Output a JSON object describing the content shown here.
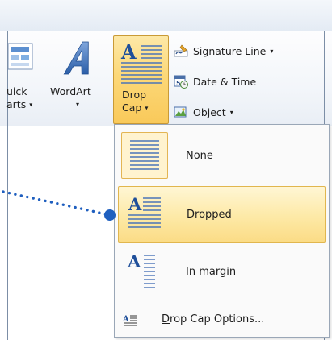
{
  "ribbon": {
    "quick_parts": {
      "label_line1": "uick",
      "label_line2": "arts"
    },
    "wordart": {
      "label": "WordArt"
    },
    "drop_cap": {
      "label_line1": "Drop",
      "label_line2": "Cap"
    },
    "signature_line": {
      "label": "Signature Line"
    },
    "date_time": {
      "label": "Date & Time"
    },
    "object": {
      "label": "Object"
    },
    "dropdown_arrow": "▾"
  },
  "drop_cap_menu": {
    "items": [
      {
        "label": "None",
        "selected": true
      },
      {
        "label": "Dropped",
        "hovered": true
      },
      {
        "label": "In margin"
      }
    ],
    "options_prefix": "D",
    "options_rest": "rop Cap Options..."
  },
  "colors": {
    "accent_hover": "#fbdc86",
    "pointer_dot": "#1f5fbf"
  }
}
